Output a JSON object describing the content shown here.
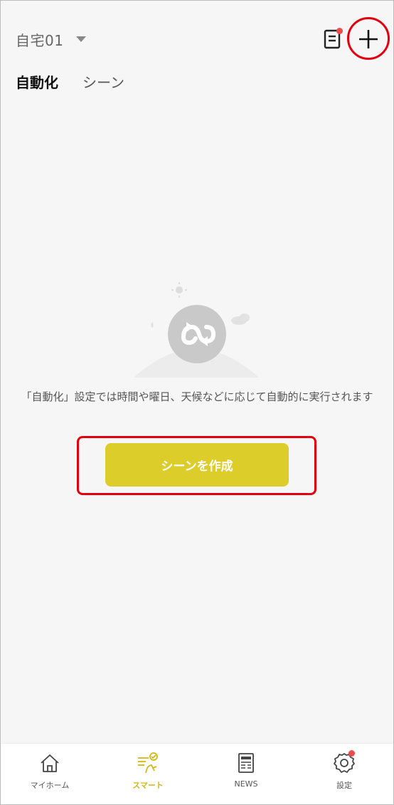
{
  "colors": {
    "accent": "#ddcd2b",
    "badge": "#f04a4a",
    "annotation": "#e2000f",
    "nav_active": "#d2b814"
  },
  "header": {
    "home_name": "自宅01",
    "home_caret_icon": "caret-down-icon",
    "log_icon": "log-icon",
    "add_icon": "plus-icon"
  },
  "tabs": [
    {
      "label": "自動化",
      "active": true
    },
    {
      "label": "シーン",
      "active": false
    }
  ],
  "empty_state": {
    "illustration_icon": "automation-loop-icon",
    "message": "「自動化」設定では時間や曜日、天候などに応じて自動的に実行されます",
    "button_label": "シーンを作成"
  },
  "bottom_nav": [
    {
      "label": "マイホーム",
      "icon": "home-icon",
      "active": false
    },
    {
      "label": "スマート",
      "icon": "smart-icon",
      "active": true
    },
    {
      "label": "NEWS",
      "icon": "news-icon",
      "active": false
    },
    {
      "label": "設定",
      "icon": "settings-icon",
      "active": false,
      "badge": true
    }
  ]
}
